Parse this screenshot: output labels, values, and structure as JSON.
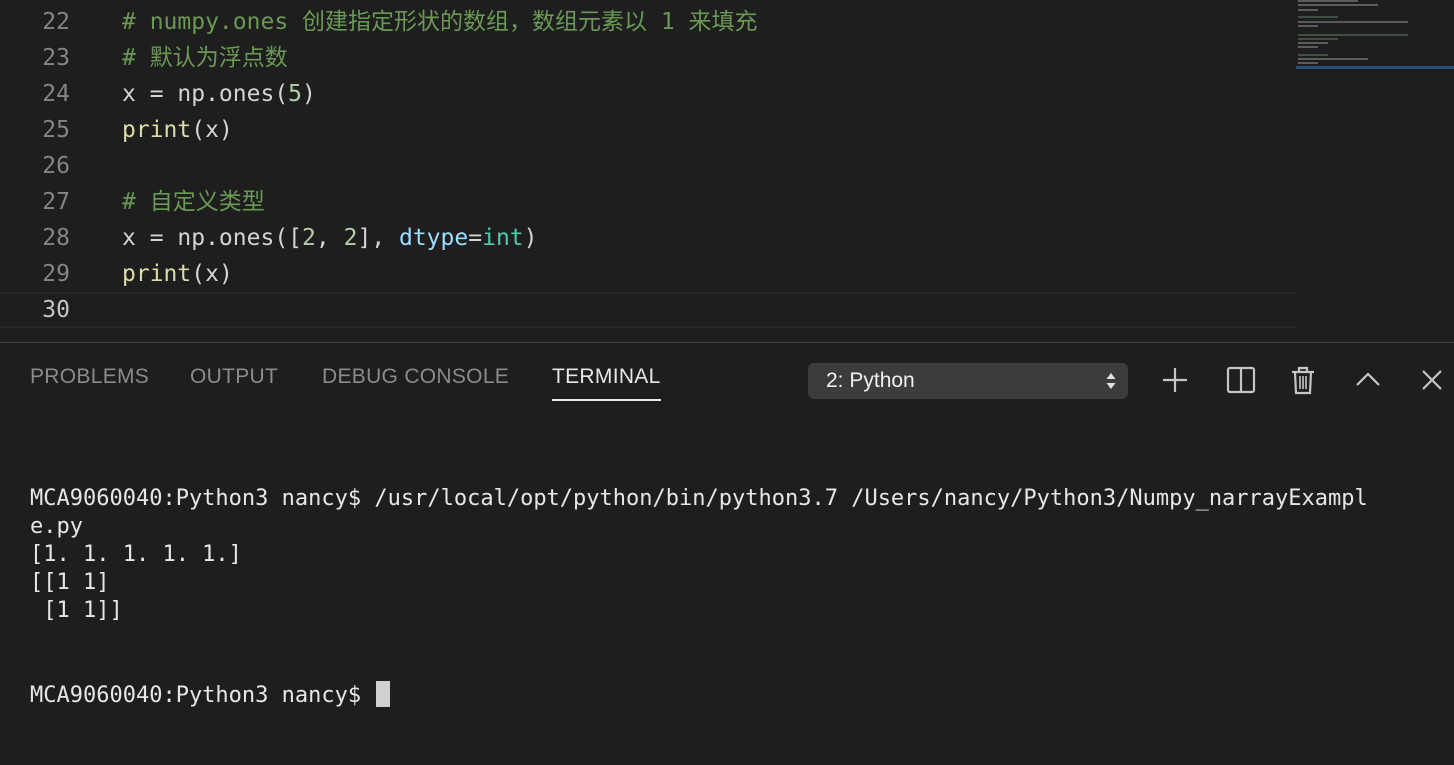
{
  "editor": {
    "lines": [
      {
        "num": "22",
        "tokens": [
          {
            "t": "# numpy.ones 创建指定形状的数组，数组元素以 1 来填充",
            "c": "comment"
          }
        ]
      },
      {
        "num": "23",
        "tokens": [
          {
            "t": "# 默认为浮点数",
            "c": "comment"
          }
        ]
      },
      {
        "num": "24",
        "tokens": [
          {
            "t": "x = np.ones(",
            "c": "plain"
          },
          {
            "t": "5",
            "c": "num"
          },
          {
            "t": ")",
            "c": "plain"
          }
        ]
      },
      {
        "num": "25",
        "tokens": [
          {
            "t": "print",
            "c": "func"
          },
          {
            "t": "(x)",
            "c": "plain"
          }
        ]
      },
      {
        "num": "26",
        "tokens": []
      },
      {
        "num": "27",
        "tokens": [
          {
            "t": "# 自定义类型",
            "c": "comment"
          }
        ]
      },
      {
        "num": "28",
        "tokens": [
          {
            "t": "x = np.ones([",
            "c": "plain"
          },
          {
            "t": "2",
            "c": "num"
          },
          {
            "t": ", ",
            "c": "plain"
          },
          {
            "t": "2",
            "c": "num"
          },
          {
            "t": "], ",
            "c": "plain"
          },
          {
            "t": "dtype",
            "c": "param"
          },
          {
            "t": "=",
            "c": "plain"
          },
          {
            "t": "int",
            "c": "type"
          },
          {
            "t": ")",
            "c": "plain"
          }
        ]
      },
      {
        "num": "29",
        "tokens": [
          {
            "t": "print",
            "c": "func"
          },
          {
            "t": "(x)",
            "c": "plain"
          }
        ]
      },
      {
        "num": "30",
        "tokens": [],
        "current": true
      }
    ]
  },
  "panel": {
    "tabs": [
      {
        "id": "problems",
        "label": "PROBLEMS",
        "active": false
      },
      {
        "id": "output",
        "label": "OUTPUT",
        "active": false
      },
      {
        "id": "debug-console",
        "label": "DEBUG CONSOLE",
        "active": false
      },
      {
        "id": "terminal",
        "label": "TERMINAL",
        "active": true
      }
    ],
    "terminal_select": {
      "value": "2: Python"
    },
    "toolbar_icons": [
      "plus-icon",
      "split-terminal-icon",
      "trash-icon",
      "chevron-up-icon",
      "close-icon"
    ]
  },
  "terminal": {
    "lines": [
      "MCA9060040:Python3 nancy$ /usr/local/opt/python/bin/python3.7 /Users/nancy/Python3/Numpy_narrayExampl",
      "e.py",
      "[1. 1. 1. 1. 1.]",
      "[[1 1]",
      " [1 1]]"
    ],
    "prompt": "MCA9060040:Python3 nancy$ "
  },
  "colors": {
    "background": "#1e1e1e",
    "comment": "#6a9955",
    "number": "#b5cea8",
    "function": "#dcdcaa",
    "parameter": "#9cdcfe",
    "type": "#4ec9b0"
  }
}
